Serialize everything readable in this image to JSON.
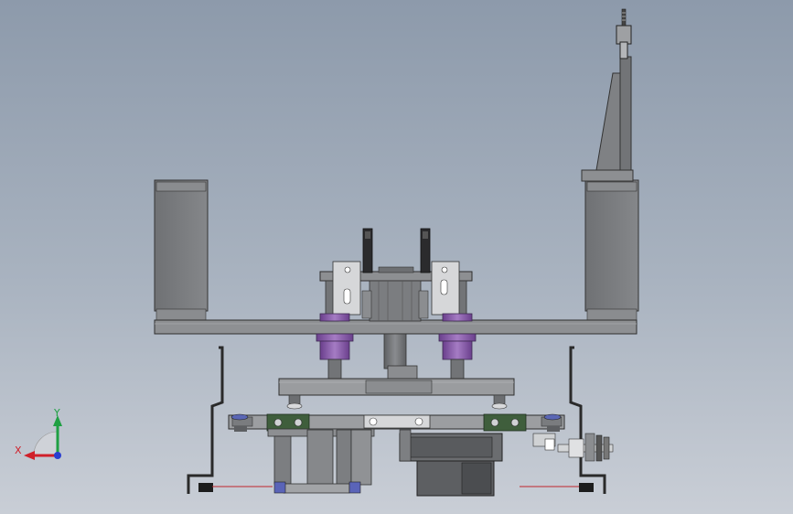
{
  "viewport": {
    "background_top": "#8d9aab",
    "background_bottom": "#c9ced6"
  },
  "colors": {
    "steel": "#7d7f82",
    "steel_dark": "#4a4b4d",
    "steel_light": "#a8aaad",
    "purple": "#8a5fa8",
    "green_block": "#3f5e3c",
    "blue_bolt": "#5a64b8",
    "axis_x": "#d0202a",
    "axis_y": "#1fa043",
    "axis_z": "#2a3fd0"
  },
  "triad": {
    "x_label": "X",
    "y_label": "Y",
    "icon": "coordinate-triad-icon"
  }
}
